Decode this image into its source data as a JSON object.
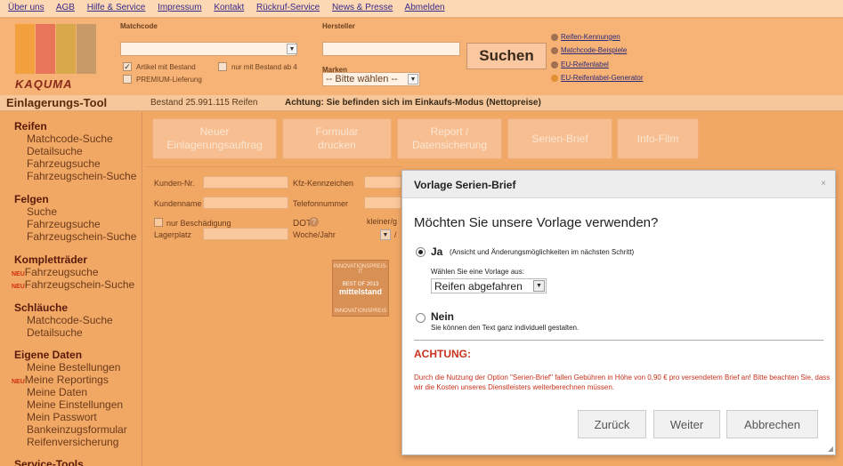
{
  "nav": [
    "Über uns",
    "AGB",
    "Hilfe & Service",
    "Impressum",
    "Kontakt",
    "Rückruf-Service",
    "News & Presse",
    "Abmelden"
  ],
  "header": {
    "logo": "KAQUMA",
    "matchcode_label": "Matchcode",
    "hersteller_label": "Hersteller",
    "search_label": "Suchen",
    "artikel_label": "Artikel mit Bestand",
    "nur_label": "nur mit Bestand ab 4",
    "premium_label": "PREMIUM-Lieferung",
    "marken_label": "Marken",
    "marken_value": "-- Bitte wählen --",
    "help_links": [
      "Reifen-Kennungen",
      "Matchcode-Beispiele",
      "EU-Reifenlabel",
      "EU-Reifenlabel-Generator"
    ]
  },
  "titlebar": {
    "tool": "Einlagerungs-Tool",
    "bestand": "Bestand  25.991.115 Reifen",
    "achtung": "Achtung: Sie befinden sich im Einkaufs-Modus (Nettopreise)"
  },
  "sidebar": {
    "reifen": "Reifen",
    "reifen_items": [
      "Matchcode-Suche",
      "Detailsuche",
      "Fahrzeugsuche",
      "Fahrzeugschein-Suche"
    ],
    "felgen": "Felgen",
    "felgen_items": [
      "Suche",
      "Fahrzeugsuche",
      "Fahrzeugschein-Suche"
    ],
    "komplett": "Kompletträder",
    "neu": "NEU",
    "komplett_items": [
      "Fahrzeugsuche",
      "Fahrzeugschein-Suche"
    ],
    "schlauche": "Schläuche",
    "schlauche_items": [
      "Matchcode-Suche",
      "Detailsuche"
    ],
    "eigene": "Eigene Daten",
    "eigene_items": [
      "Meine Bestellungen",
      "Meine Reportings",
      "Meine Daten",
      "Meine Einstellungen",
      "Mein Passwort",
      "Bankeinzugsformular",
      "Reifenversicherung"
    ],
    "service": "Service-Tools"
  },
  "toolbar": {
    "neuer_1": "Neuer",
    "neuer_2": "Einlagerungsauftrag",
    "formular_1": "Formular",
    "formular_2": "drucken",
    "report_1": "Report /",
    "report_2": "Datensicherung",
    "serien": "Serien-Brief",
    "info": "Info-Film"
  },
  "form": {
    "kunden_nr": "Kunden-Nr.",
    "kundenname": "Kundenname",
    "beschaedigung": "nur Beschädigung",
    "lagerplatz": "Lagerplatz",
    "kfz": "Kfz-Kennzeichen",
    "telefon": "Telefonnummer",
    "dot_1": "DOT",
    "dot_2": "Woche/Jahr",
    "kleiner": "kleiner/g",
    "slash": "/"
  },
  "badge": {
    "l1": "INNOVATIONSPREIS-IT",
    "l2": "BEST OF 2013",
    "l3": "mittelstand",
    "l4": "INNOVATIONSPREIS"
  },
  "dialog": {
    "title": "Vorlage Serien-Brief",
    "close": "×",
    "question": "Möchten Sie unsere Vorlage verwenden?",
    "ja": "Ja",
    "ja_note": "(Ansicht und Änderungsmöglichkeiten im nächsten Schritt)",
    "wahlen": "Wählen Sie eine Vorlage aus:",
    "select_value": "Reifen abgefahren",
    "nein": "Nein",
    "nein_note": "Sie können den Text ganz individuell gestalten.",
    "achtung_heading": "ACHTUNG:",
    "achtung_text": "Durch die Nutzung der Option \"Serien-Brief\" fallen Gebühren in Höhe von 0,90 € pro versendetem Brief an! Bitte beachten Sie, dass wir die Kosten unseres Dienstleisters weiterberechnen müssen.",
    "zuruck": "Zurück",
    "weiter": "Weiter",
    "abbrechen": "Abbrechen"
  },
  "colors": {
    "page": "#f2a865",
    "warning": "#c8321e",
    "link": "#3a2a8a"
  }
}
